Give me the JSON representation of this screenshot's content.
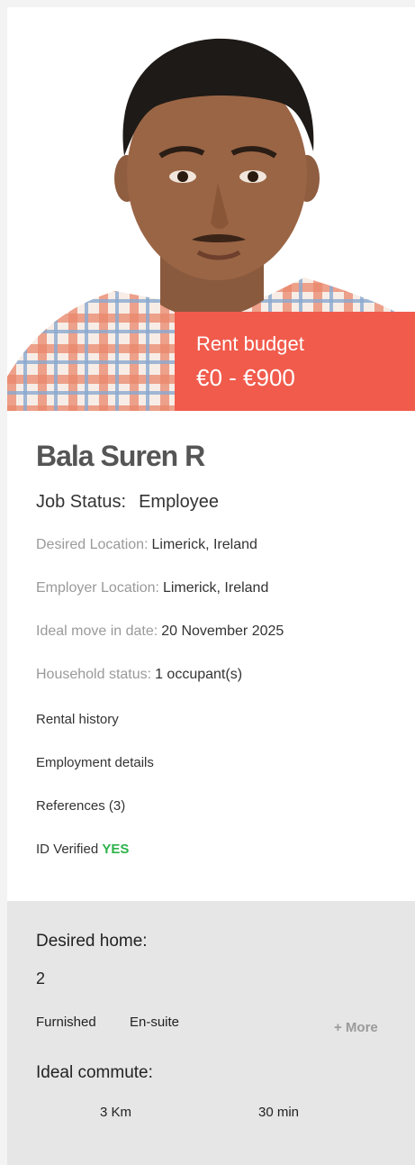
{
  "rent_budget": {
    "label": "Rent budget",
    "value": "€0 - €900"
  },
  "profile": {
    "name": "Bala Suren R",
    "job_status_label": "Job Status:",
    "job_status_value": "Employee"
  },
  "details": {
    "desired_location_label": "Desired Location:",
    "desired_location_value": "Limerick, Ireland",
    "employer_location_label": "Employer Location:",
    "employer_location_value": "Limerick, Ireland",
    "move_in_label": "Ideal move in date:",
    "move_in_value": "20 November 2025",
    "household_label": "Household status:",
    "household_value": "1 occupant(s)"
  },
  "links": {
    "rental_history": "Rental history",
    "employment_details": "Employment details",
    "references": "References (3)",
    "id_verified_label": "ID Verified",
    "id_verified_value": "YES"
  },
  "desired_home": {
    "title": "Desired home:",
    "bedrooms": "2",
    "features": [
      "Furnished",
      "En-suite"
    ],
    "more_label": "+ More"
  },
  "commute": {
    "title": "Ideal commute:",
    "distance": "3 Km",
    "time": "30 min"
  },
  "colors": {
    "budget_bg": "#f15b4c",
    "verified": "#2db34a",
    "section_bg": "#e6e6e6"
  }
}
